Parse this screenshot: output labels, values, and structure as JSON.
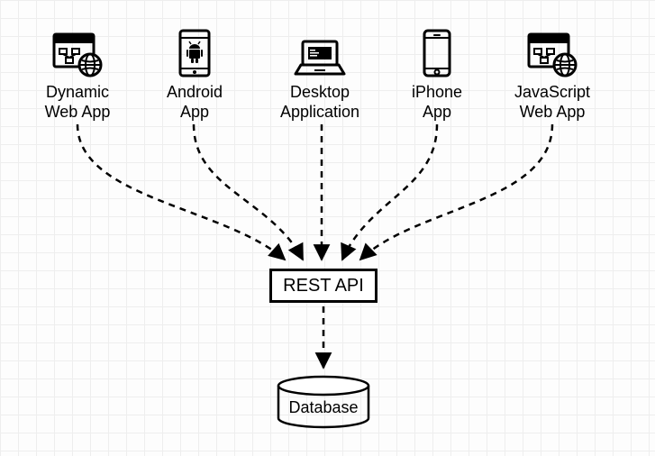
{
  "nodes": {
    "dynamic": {
      "line1": "Dynamic",
      "line2": "Web App"
    },
    "android": {
      "line1": "Android",
      "line2": "App"
    },
    "desktop": {
      "line1": "Desktop",
      "line2": "Application"
    },
    "iphone": {
      "line1": "iPhone",
      "line2": "App"
    },
    "js": {
      "line1": "JavaScript",
      "line2": "Web App"
    }
  },
  "rest_api": "REST API",
  "database": "Database",
  "diagram": {
    "description": "Five client applications (Dynamic Web App, Android App, Desktop Application, iPhone App, JavaScript Web App) all connect via dashed arrows to a central REST API box, which in turn connects via a dashed arrow to a Database cylinder.",
    "flows": [
      "Dynamic Web App -> REST API",
      "Android App -> REST API",
      "Desktop Application -> REST API",
      "iPhone App -> REST API",
      "JavaScript Web App -> REST API",
      "REST API -> Database"
    ]
  }
}
